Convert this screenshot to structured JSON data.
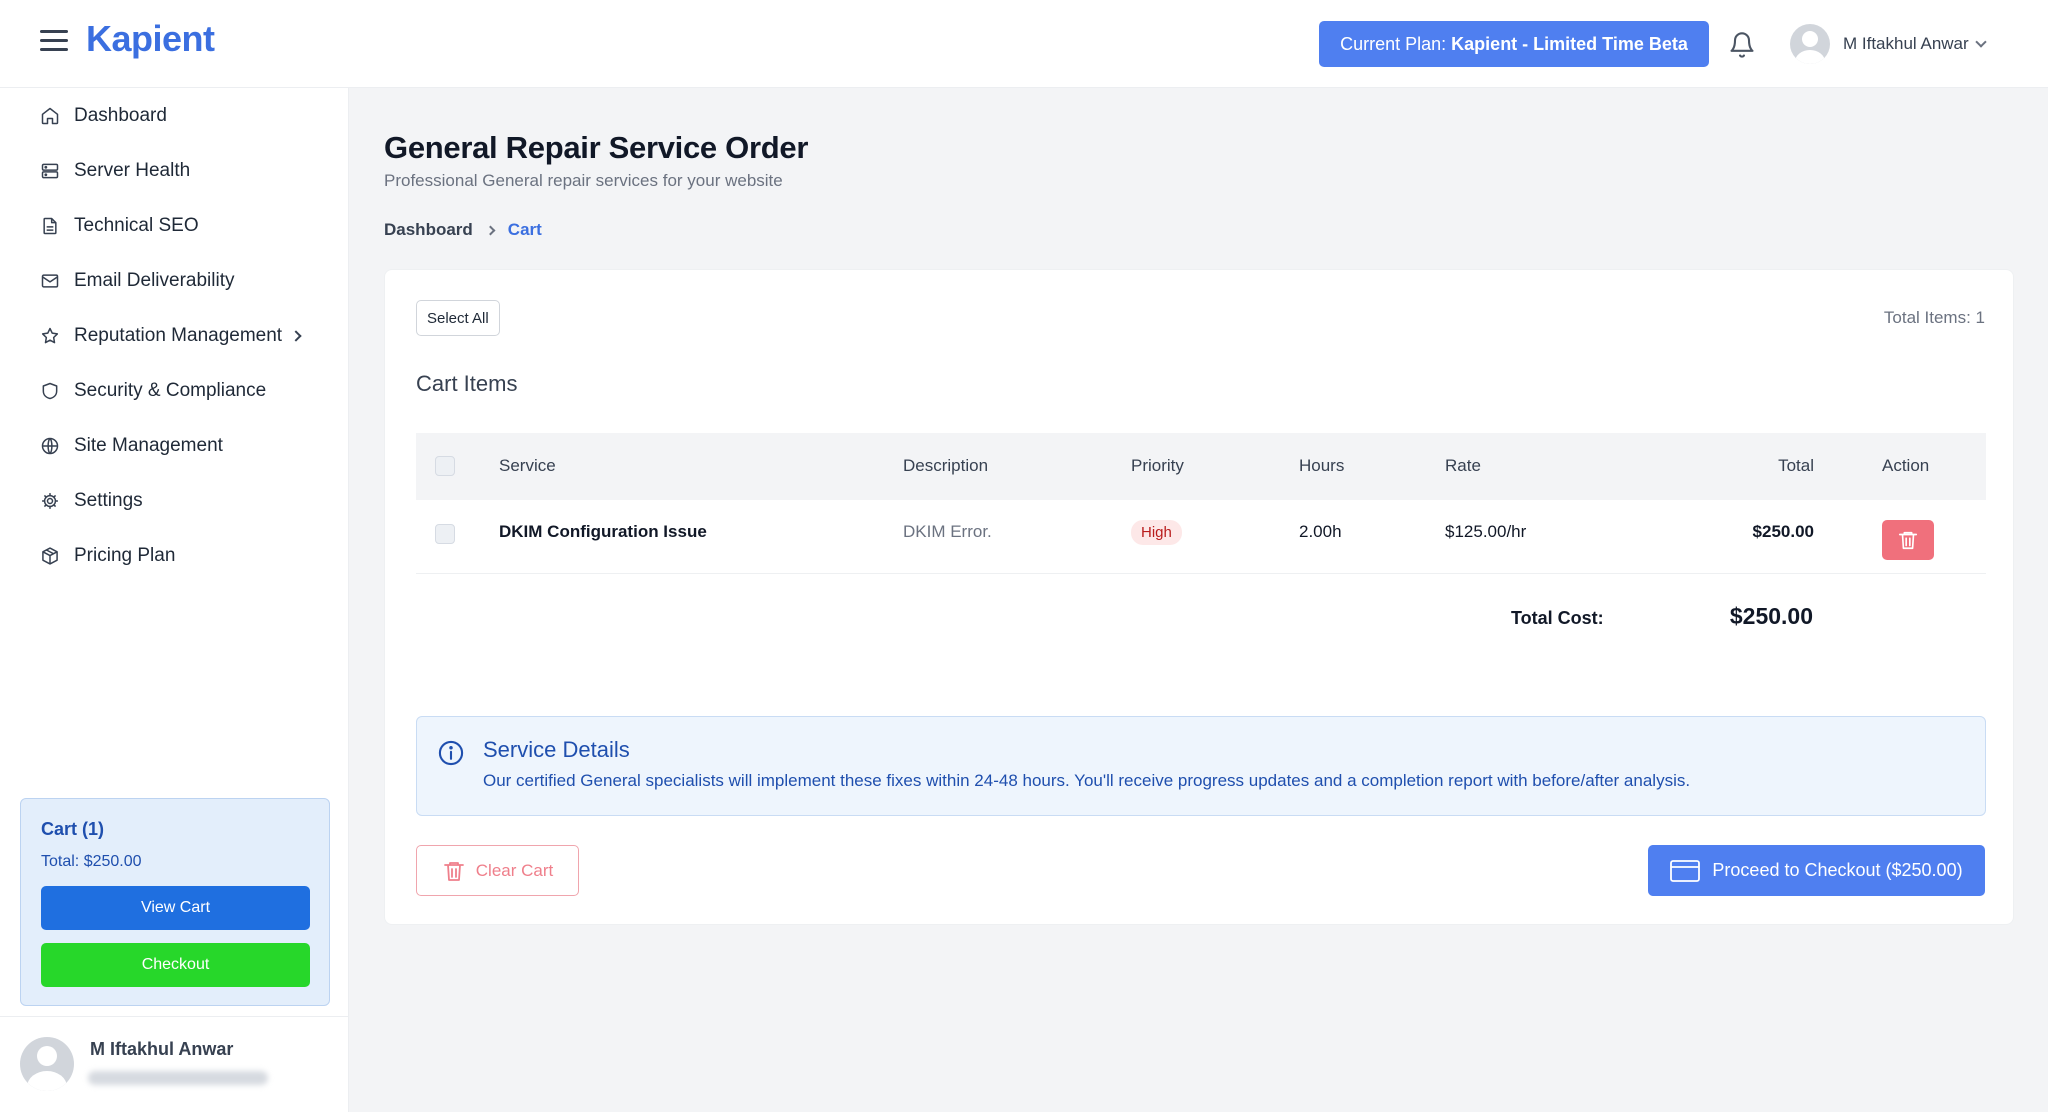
{
  "header": {
    "logo": "Kapient",
    "plan_prefix": "Current Plan:",
    "plan_name": "Kapient - Limited Time Beta",
    "user_name": "M Iftakhul Anwar"
  },
  "sidebar": {
    "items": [
      {
        "label": "Dashboard",
        "icon": "home-icon"
      },
      {
        "label": "Server Health",
        "icon": "server-icon"
      },
      {
        "label": "Technical SEO",
        "icon": "document-icon"
      },
      {
        "label": "Email Deliverability",
        "icon": "mail-icon"
      },
      {
        "label": "Reputation Management",
        "icon": "star-icon"
      },
      {
        "label": "Security & Compliance",
        "icon": "shield-icon"
      },
      {
        "label": "Site Management",
        "icon": "globe-icon"
      },
      {
        "label": "Settings",
        "icon": "gear-icon"
      },
      {
        "label": "Pricing Plan",
        "icon": "package-icon"
      }
    ],
    "cart": {
      "title": "Cart (1)",
      "total": "Total: $250.00",
      "view_cart": "View Cart",
      "checkout": "Checkout"
    },
    "user_name": "M Iftakhul Anwar"
  },
  "main": {
    "title": "General Repair Service Order",
    "subtitle": "Professional General repair services for your website",
    "breadcrumb": {
      "home": "Dashboard",
      "current": "Cart"
    },
    "select_all": "Select All",
    "total_items": "Total Items: 1",
    "cart_items_title": "Cart Items",
    "columns": {
      "service": "Service",
      "description": "Description",
      "priority": "Priority",
      "hours": "Hours",
      "rate": "Rate",
      "total": "Total",
      "action": "Action"
    },
    "rows": [
      {
        "service": "DKIM Configuration Issue",
        "description": "DKIM Error.",
        "priority": "High",
        "hours": "2.00h",
        "rate": "$125.00/hr",
        "total": "$250.00"
      }
    ],
    "total_cost_label": "Total Cost:",
    "total_cost_value": "$250.00",
    "service_details": {
      "title": "Service Details",
      "text": "Our certified General specialists will implement these fixes within 24-48 hours. You'll receive progress updates and a completion report with before/after analysis."
    },
    "clear_cart": "Clear Cart",
    "proceed": "Proceed to Checkout ($250.00)"
  },
  "colors": {
    "accent": "#4f7ff0",
    "logo": "#3b6fe0",
    "checkout_green": "#27d72a",
    "danger": "#f0707c"
  }
}
